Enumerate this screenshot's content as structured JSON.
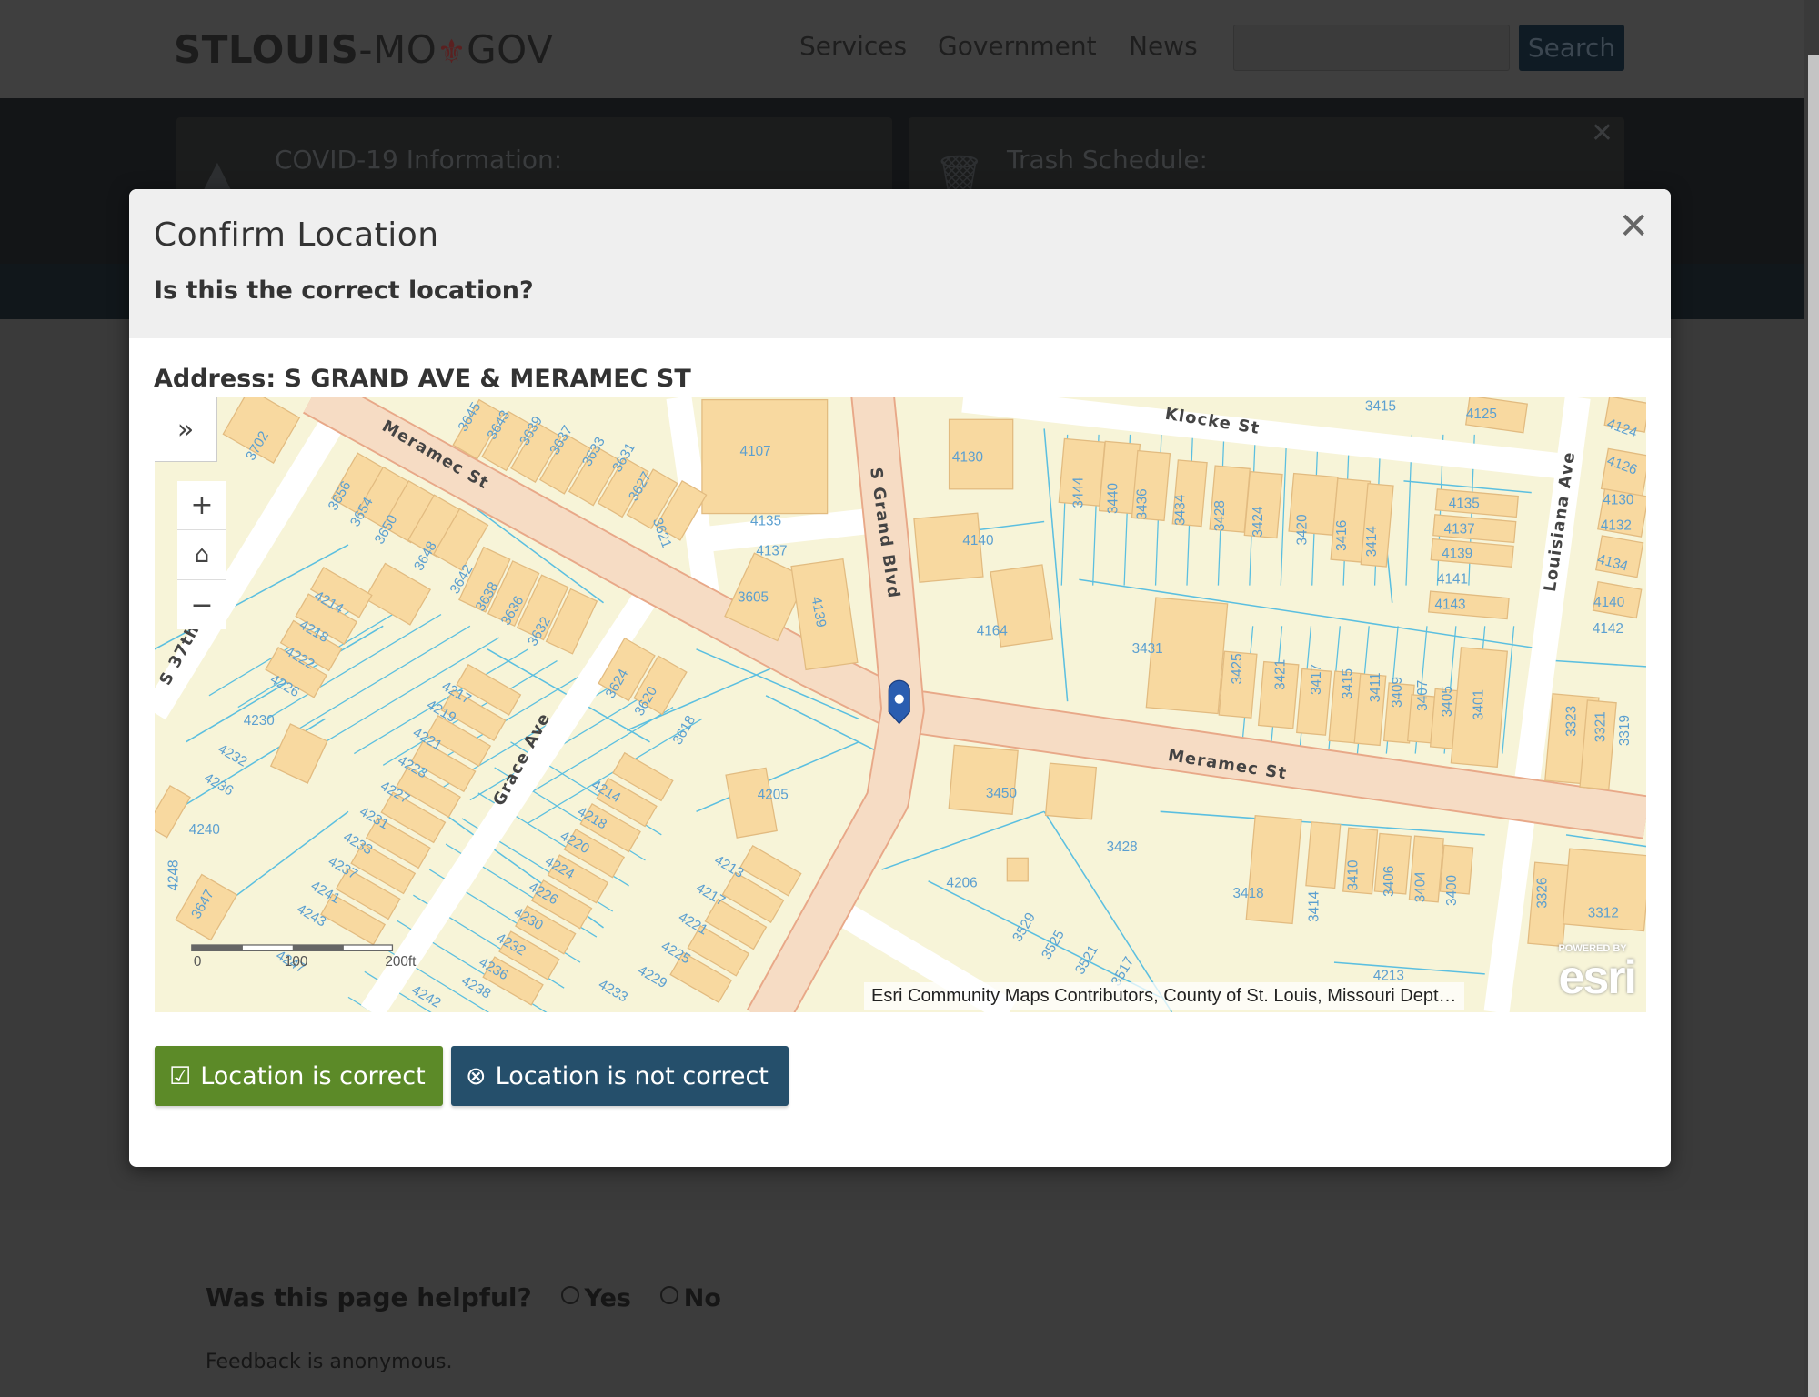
{
  "header": {
    "logo_bold": "STLOUIS",
    "logo_rest_1": "-MO",
    "logo_rest_2": "GOV",
    "nav": [
      "Services",
      "Government",
      "News"
    ],
    "search_placeholder": "",
    "search_label": "Search"
  },
  "alerts": [
    {
      "title": "COVID-19 Information:",
      "icon": "warning-icon"
    },
    {
      "title": "Trash Schedule:",
      "icon": "trash-icon"
    }
  ],
  "modal": {
    "title": "Confirm Location",
    "subtitle": "Is this the correct location?",
    "address": "Address: S GRAND AVE & MERAMEC ST",
    "buttons": {
      "correct": "Location is correct",
      "not_correct": "Location is not correct"
    }
  },
  "map": {
    "streets": [
      "Meramec St",
      "Meramec St",
      "S Grand Blvd",
      "Klocke St",
      "Louisiana Ave",
      "Grace Ave",
      "S 37th"
    ],
    "parcels": [
      "4107",
      "4135",
      "4137",
      "3605",
      "4139",
      "3702",
      "3645",
      "3643",
      "3639",
      "3637",
      "3633",
      "3631",
      "3627",
      "3621",
      "3656",
      "3654",
      "3650",
      "3648",
      "3642",
      "3638",
      "3636",
      "3632",
      "4214",
      "4218",
      "4222",
      "4226",
      "4230",
      "4232",
      "4236",
      "4240",
      "4248",
      "3647",
      "4217",
      "4219",
      "4221",
      "4223",
      "4227",
      "4231",
      "4233",
      "4237",
      "4241",
      "4243",
      "4247",
      "4242",
      "3624",
      "3620",
      "3618",
      "4214",
      "4218",
      "4220",
      "4224",
      "4226",
      "4230",
      "4232",
      "4236",
      "4238",
      "4205",
      "4213",
      "4217",
      "4221",
      "4225",
      "4229",
      "4233",
      "4130",
      "4140",
      "4164",
      "3444",
      "3440",
      "3436",
      "3434",
      "3428",
      "3424",
      "3420",
      "3416",
      "3414",
      "4135",
      "4137",
      "4139",
      "4141",
      "4143",
      "3415",
      "4125",
      "4124",
      "4126",
      "4130",
      "4132",
      "4134",
      "4140",
      "4142",
      "3431",
      "3425",
      "3421",
      "3417",
      "3415",
      "3411",
      "3409",
      "3407",
      "3405",
      "3401",
      "3323",
      "3321",
      "3319",
      "3450",
      "3428",
      "4206",
      "3418",
      "3414",
      "3410",
      "3406",
      "3404",
      "3400",
      "3326",
      "3312",
      "3529",
      "3525",
      "3521",
      "3517",
      "4213"
    ],
    "scale": [
      "0",
      "100",
      "200ft"
    ],
    "attribution": "Esri Community Maps Contributors, County of St. Louis, Missouri Dept…",
    "logo": "esri",
    "logo_caption": "POWERED BY",
    "colors": {
      "land": "#f7f4d8",
      "building": "#f8d9a0",
      "parcel_line": "#5bbfe0",
      "major_road": "#f6dcc4",
      "minor_road": "#ffffff",
      "pin": "#2a5db0"
    }
  },
  "feedback": {
    "question": "Was this page helpful?",
    "yes": "Yes",
    "no": "No",
    "note": "Feedback is anonymous."
  }
}
